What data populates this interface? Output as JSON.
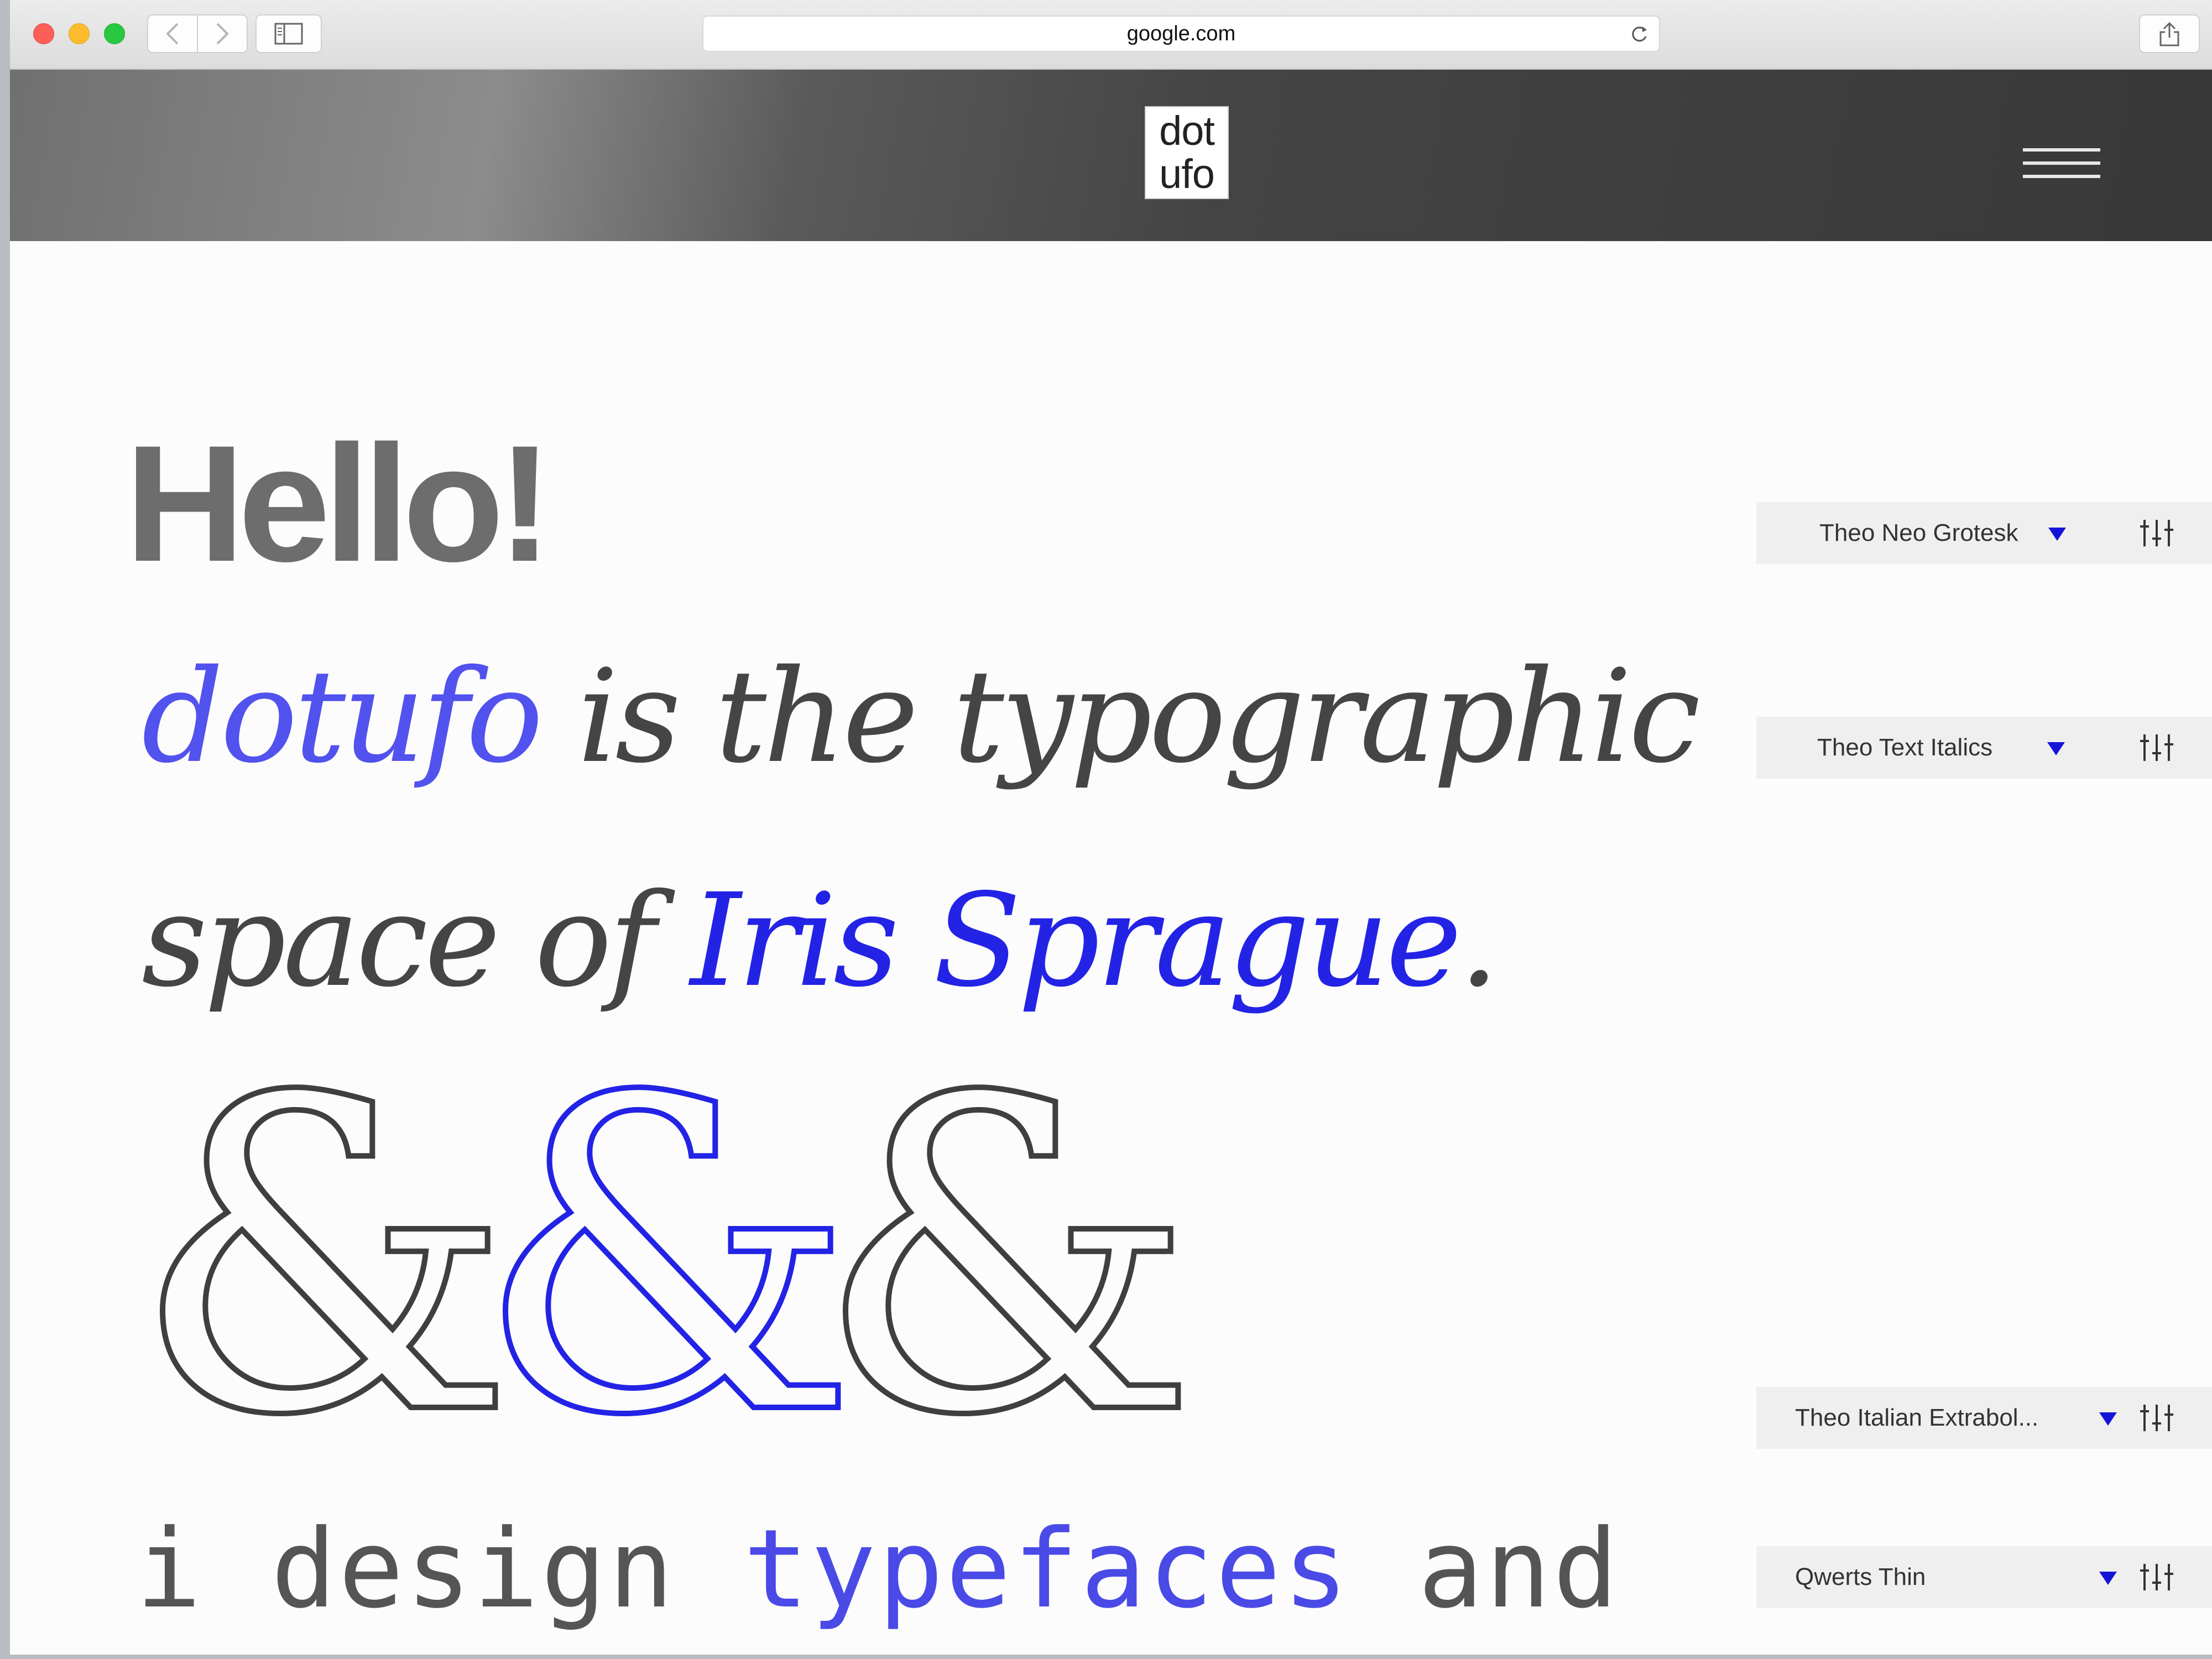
{
  "browser": {
    "url": "google.com"
  },
  "site": {
    "logo_line1": "dot",
    "logo_line2": "ufo"
  },
  "hero": {
    "hello": "Hello!",
    "line1_accent": "dotufo",
    "line1_rest": " is the typographic",
    "line2_start": "space of ",
    "line2_accent": "Iris Sprague",
    "line2_end": ".",
    "ampersand_glyph": "&",
    "mono_start": "i design ",
    "mono_accent": "typefaces",
    "mono_end": " and"
  },
  "pickers": [
    {
      "label": "Theo Neo Grotesk"
    },
    {
      "label": "Theo Text Italics"
    },
    {
      "label": "Theo Italian Extrabol..."
    },
    {
      "label": "Qwerts Thin"
    }
  ],
  "colors": {
    "accent_blue": "#2323e6",
    "accent_light": "#5252ee",
    "text_dark": "#454545",
    "header_dark": "#383838"
  },
  "icons": {
    "dropdown": "triangle-down-icon",
    "adjust": "sliders-icon",
    "menu": "hamburger-icon"
  }
}
